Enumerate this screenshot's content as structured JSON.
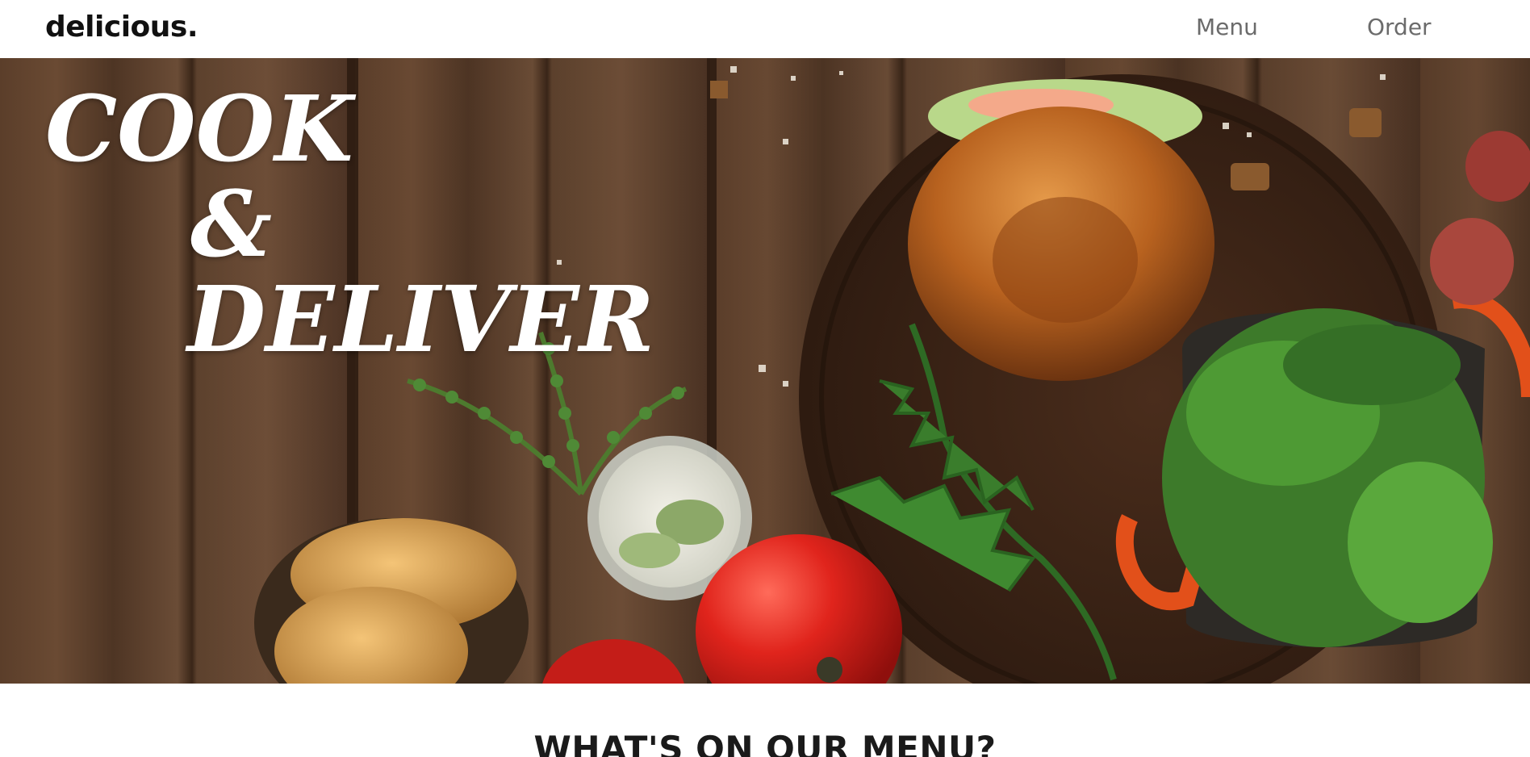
{
  "header": {
    "brand": "delicious.",
    "nav": [
      {
        "label": "Menu"
      },
      {
        "label": "Order"
      }
    ]
  },
  "hero": {
    "title_lines": [
      "COOK",
      "&",
      "DELIVER"
    ]
  },
  "section": {
    "title": "WHAT'S ON OUR MENU?"
  },
  "colors": {
    "wood_dark": "#3a2618",
    "wood_mid": "#6a4a33",
    "bun": "#c0732c",
    "tomato": "#d91f1a",
    "greens": "#3d7a2a",
    "pot_orange": "#e2501a"
  }
}
